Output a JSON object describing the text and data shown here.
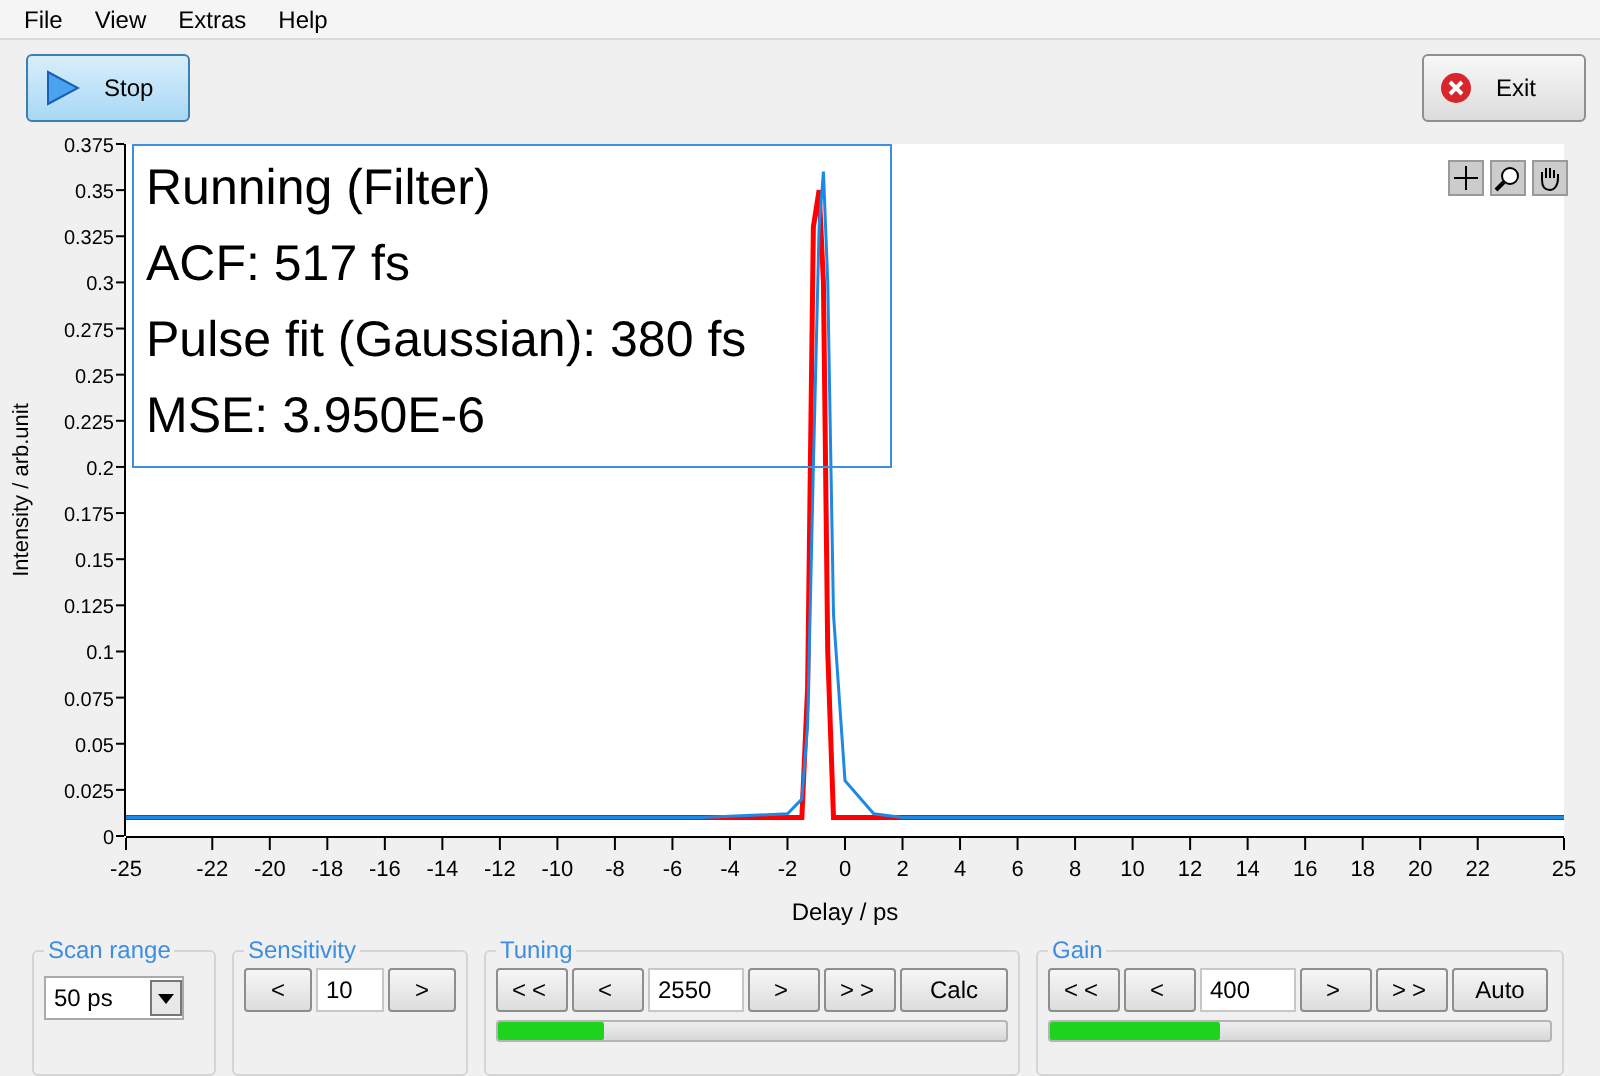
{
  "menu": [
    "File",
    "View",
    "Extras",
    "Help"
  ],
  "toolbar": {
    "start_button": "Stop",
    "exit_button": "Exit"
  },
  "status_overlay": [
    "Running (Filter)",
    "ACF: 517 fs",
    "Pulse fit (Gaussian): 380 fs",
    "MSE: 3.950E-6"
  ],
  "chart": {
    "chart_data": {
      "type": "line",
      "xlabel": "Delay / ps",
      "ylabel": "Intensity / arb.unit",
      "x": [
        -25,
        -5,
        -2,
        -1.5,
        -1.3,
        -1.1,
        -0.9,
        -0.75,
        -0.6,
        -0.4,
        0,
        1,
        2,
        25
      ],
      "series": [
        {
          "color": "#ff0000",
          "values": [
            0.01,
            0.01,
            0.01,
            0.01,
            0.08,
            0.33,
            0.35,
            0.3,
            0.1,
            0.01,
            0.01,
            0.01,
            0.01,
            0.01
          ]
        },
        {
          "color": "#1e88e5",
          "values": [
            0.01,
            0.01,
            0.012,
            0.02,
            0.06,
            0.2,
            0.33,
            0.36,
            0.3,
            0.12,
            0.03,
            0.012,
            0.01,
            0.01
          ]
        }
      ],
      "xlim": [
        -25,
        25
      ],
      "ylim": [
        0,
        0.375
      ],
      "xticks": [
        -25,
        -22,
        -20,
        -18,
        -16,
        -14,
        -12,
        -10,
        -8,
        -6,
        -4,
        -2,
        0,
        2,
        4,
        6,
        8,
        10,
        12,
        14,
        16,
        18,
        20,
        22,
        25
      ],
      "yticks": [
        0,
        0.025,
        0.05,
        0.075,
        0.1,
        0.125,
        0.15,
        0.175,
        0.2,
        0.225,
        0.25,
        0.275,
        0.3,
        0.325,
        0.35,
        0.375
      ]
    }
  },
  "scan_range": {
    "label": "Scan range",
    "value": "50 ps"
  },
  "sensitivity": {
    "label": "Sensitivity",
    "decrease": "<",
    "value": "10",
    "increase": ">"
  },
  "tuning": {
    "label": "Tuning",
    "left_buttons": [
      "<<",
      "<"
    ],
    "value": "2550",
    "right_buttons": [
      ">",
      ">>"
    ],
    "action": "Calc",
    "level": 0.21
  },
  "gain": {
    "label": "Gain",
    "left_buttons": [
      "<<",
      "<"
    ],
    "value": "400",
    "right_buttons": [
      ">",
      ">>"
    ],
    "action": "Auto",
    "level": 0.34
  }
}
